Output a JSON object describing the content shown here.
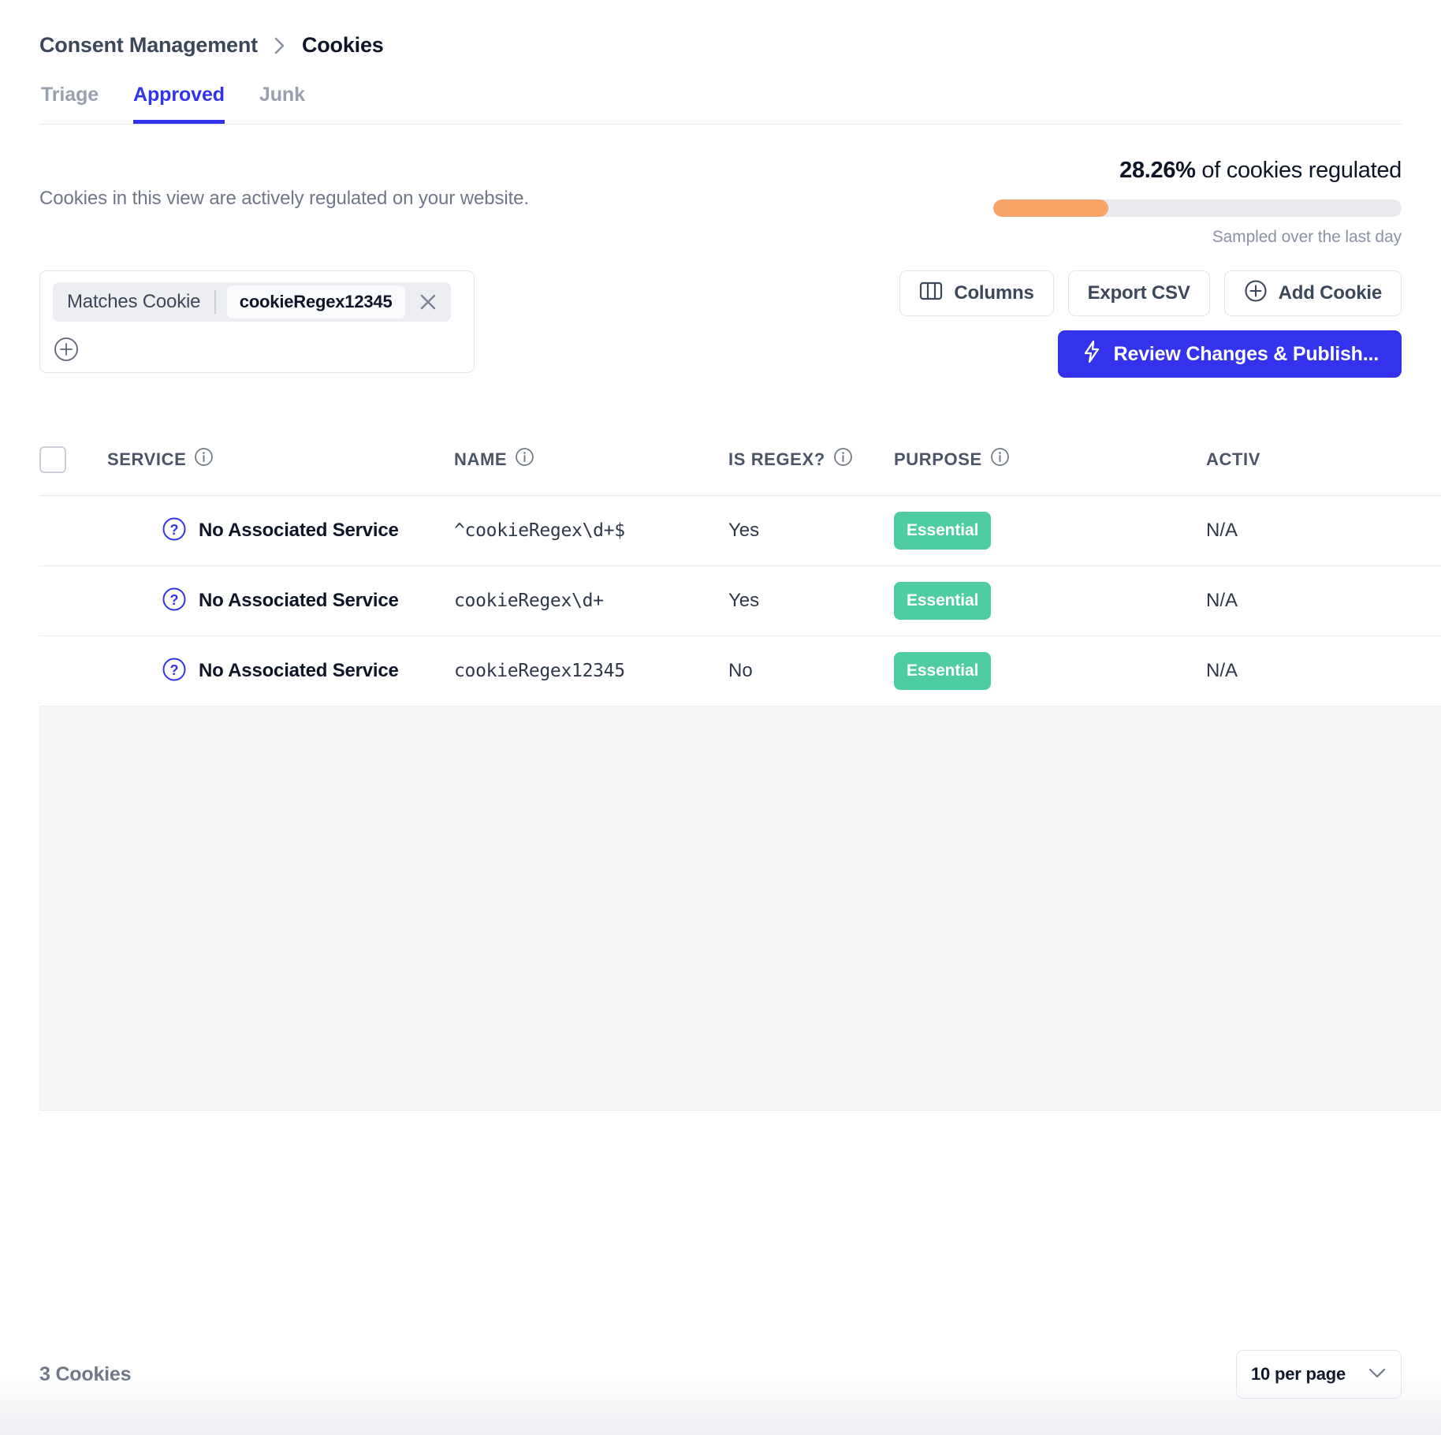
{
  "breadcrumb": {
    "root": "Consent Management",
    "current": "Cookies"
  },
  "tabs": [
    {
      "label": "Triage",
      "active": false
    },
    {
      "label": "Approved",
      "active": true
    },
    {
      "label": "Junk",
      "active": false
    }
  ],
  "intro": {
    "description": "Cookies in this view are actively regulated on your website."
  },
  "stats": {
    "percent": "28.26%",
    "percent_value": 28.26,
    "suffix": " of cookies regulated",
    "caption": "Sampled over the last day",
    "bar_color": "#f9a468",
    "track_color": "#e9eaed"
  },
  "filter": {
    "chip_label": "Matches Cookie",
    "chip_value": "cookieRegex12345",
    "remove_icon": "close-icon",
    "add_icon": "plus-circle-icon"
  },
  "toolbar": {
    "columns_label": "Columns",
    "export_label": "Export CSV",
    "add_cookie_label": "Add Cookie",
    "publish_label": "Review Changes & Publish...",
    "primary_color": "#3333ee"
  },
  "table": {
    "columns": [
      {
        "label": "SERVICE",
        "info": true
      },
      {
        "label": "NAME",
        "info": true
      },
      {
        "label": "IS REGEX?",
        "info": true
      },
      {
        "label": "PURPOSE",
        "info": true
      },
      {
        "label": "ACTIV",
        "info": false
      }
    ],
    "rows": [
      {
        "service": "No Associated Service",
        "name": "^cookieRegex\\d+$",
        "is_regex": "Yes",
        "purpose": "Essential",
        "active": "N/A"
      },
      {
        "service": "No Associated Service",
        "name": "cookieRegex\\d+",
        "is_regex": "Yes",
        "purpose": "Essential",
        "active": "N/A"
      },
      {
        "service": "No Associated Service",
        "name": "cookieRegex12345",
        "is_regex": "No",
        "purpose": "Essential",
        "active": "N/A"
      }
    ],
    "badge_color": "#4ecca3"
  },
  "footer": {
    "count_label": "3 Cookies",
    "per_page_label": "10 per page"
  }
}
